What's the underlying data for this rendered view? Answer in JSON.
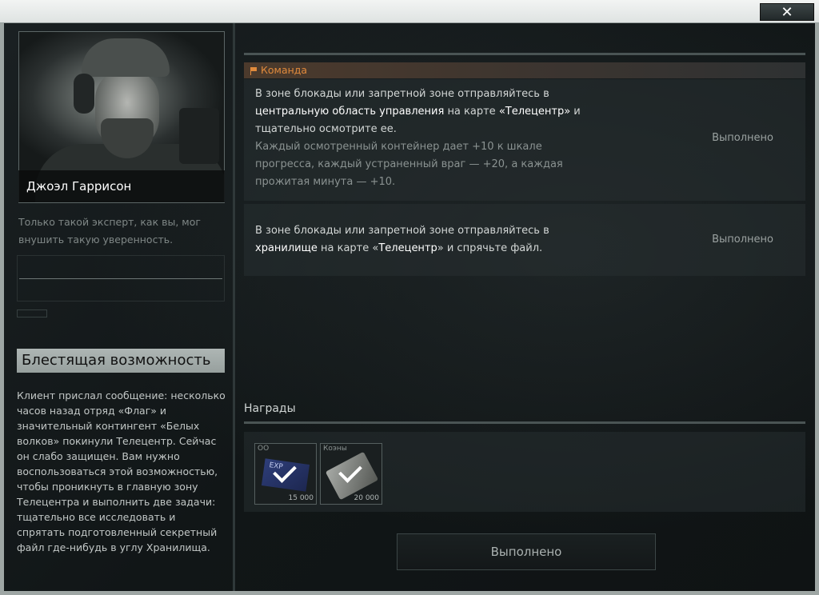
{
  "window": {
    "close_label": "✕"
  },
  "trader": {
    "name": "Джоэл Гаррисон",
    "quote": "Только такой эксперт, как вы, мог внушить такую уверенность."
  },
  "quest": {
    "title": "Блестящая возможность",
    "description": "Клиент прислал сообщение: несколько часов назад отряд «Флаг» и значительный контингент «Белых волков» покинули Телецентр. Сейчас он слабо защищен. Вам нужно воспользоваться этой возможностью, чтобы проникнуть в главную зону Телецентра и выполнить две задачи: тщательно все исследовать и спрятать подготовленный секретный файл где-нибудь в углу Хранилища."
  },
  "tasks": {
    "header": "Команда",
    "items": [
      {
        "text_1": "В зоне блокады или запретной зоне отправляйтесь в",
        "text_bold": "центральную область управления",
        "text_2": "на карте",
        "text_3_bold": "«Телецентр»",
        "text_4": "и тщательно осмотрите ее.",
        "hint": "Каждый осмотренный контейнер дает +10 к шкале прогресса, каждый устраненный враг — +20, а каждая прожитая минута — +10.",
        "status": "Выполнено"
      },
      {
        "text_1": "В зоне блокады или запретной зоне отправляйтесь в",
        "text_bold": "хранилище",
        "text_2": "на карте «",
        "text_3_bold": "Телецентр",
        "text_4": "» и спрячьте файл.",
        "status": "Выполнено"
      }
    ]
  },
  "rewards": {
    "label": "Награды",
    "items": [
      {
        "name": "ОО",
        "value": "15 000",
        "card_text": "EXP",
        "icon": "exp-card-icon"
      },
      {
        "name": "Коэны",
        "value": "20 000",
        "icon": "coin-stack-icon"
      }
    ]
  },
  "footer": {
    "button_label": "Выполнено"
  }
}
